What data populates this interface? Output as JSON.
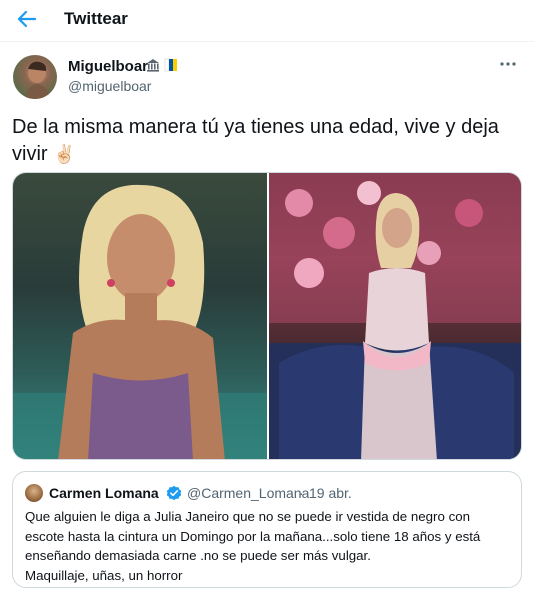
{
  "header": {
    "title": "Twittear",
    "back_icon": "arrow-left-icon"
  },
  "tweet": {
    "author_name": "Miguelboar",
    "author_handle": "@miguelboar",
    "badges": [
      "classical-building-icon",
      "canary-islands-flag-icon"
    ],
    "text": "De la misma manera tú ya tienes una edad, vive y deja vivir",
    "emoji": "✌🏻",
    "more_icon": "more-options-icon"
  },
  "quoted_tweet": {
    "author_name": "Carmen Lomana",
    "verified": true,
    "author_handle": "@Carmen_Lomana",
    "separator": "·",
    "date": "19 abr.",
    "text": "Que alguien le diga a Julia Janeiro que no se puede ir vestida de negro con escote hasta la cintura un Domingo por la mañana...solo tiene 18 años y está enseñando demasiada carne .no se puede ser más vulgar.",
    "text2": "Maquillaje, uñas, un horror"
  },
  "colors": {
    "accent": "#1d9bf0",
    "text": "#0f1419",
    "secondary_text": "#536471",
    "border": "#cfd9de"
  }
}
